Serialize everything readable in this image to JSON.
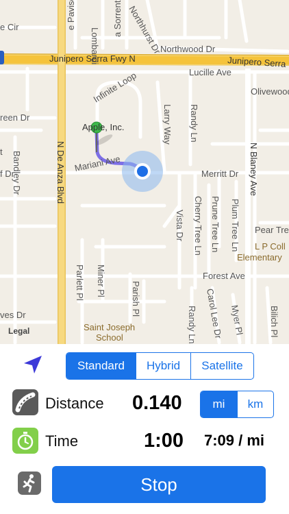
{
  "map": {
    "streets": {
      "freeway": "Junipero Serra Fwy N",
      "freeway_right": "Junipero Serra",
      "northwood": "Northwood Dr",
      "lucille": "Lucille Ave",
      "olivewood": "Olivewood",
      "infinite_loop": "Infinite Loop",
      "larry_way": "Larry Way",
      "randy_ln_top": "Randy Ln",
      "randy_ln_bottom": "Randy Ln",
      "green_dr": "reen Dr",
      "n_de_anza": "N De Anza Blvd",
      "bandley": "Bandley Dr",
      "f_dr": "f Dr",
      "mariani": "Mariani Ave",
      "merritt": "Merritt Dr",
      "n_blaney": "N Blaney Ave",
      "vista": "Vista Dr",
      "cherry_tree": "Cherry Tree Ln",
      "prune_tree": "Prune Tree Ln",
      "plum_tree": "Plum Tree Ln",
      "pear_tree": "Pear Tree",
      "lp_coll": "L P Coll",
      "elementary": "Elementary",
      "forest": "Forest Ave",
      "parish": "Parish Pl",
      "parlett": "Parlett Pl",
      "miner": "Miner Pl",
      "carol_lee": "Carol Lee Dr",
      "myer": "Myer Pl",
      "bilich": "Bilich Pl",
      "ves_dr": "ves Dr",
      "e_cir": "e Cir",
      "pavisio": "e Paviso",
      "lombardi": "Lombardi",
      "sorrento": "a Sorrento",
      "northhurst": "Northhurst Dr",
      "saint_joseph": "Saint Joseph",
      "school": "School",
      "t_label": "t"
    },
    "poi": "Apple, Inc.",
    "legal": "Legal"
  },
  "mode_tabs": {
    "items": [
      "Standard",
      "Hybrid",
      "Satellite"
    ],
    "active": "Standard"
  },
  "distance": {
    "label": "Distance",
    "value": "0.140",
    "units": [
      "mi",
      "km"
    ],
    "active_unit": "mi"
  },
  "time": {
    "label": "Time",
    "value": "1:00",
    "pace": "7:09 / mi"
  },
  "stop_button": {
    "label": "Stop"
  },
  "colors": {
    "accent": "#1a73e8",
    "route": "#6a6ae8",
    "location": "#1e6fe6",
    "pin": "#3db84a",
    "freeway": "#f5c33b",
    "map_bg": "#f2eee6"
  }
}
